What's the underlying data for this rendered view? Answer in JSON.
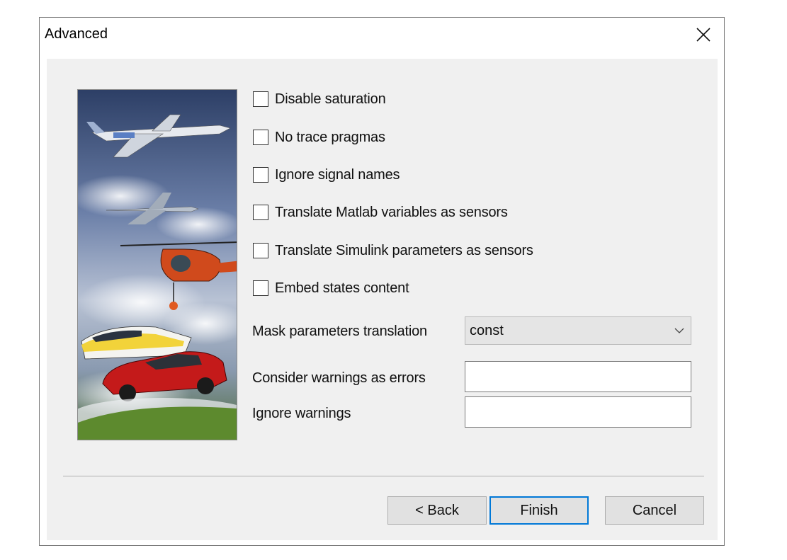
{
  "dialog": {
    "title": "Advanced",
    "close_icon": "close-icon"
  },
  "picture": {
    "description_icon": "vehicles-collage-image"
  },
  "options": [
    {
      "label": "Disable saturation",
      "checked": false
    },
    {
      "label": "No trace pragmas",
      "checked": false
    },
    {
      "label": "Ignore signal names",
      "checked": false
    },
    {
      "label": "Translate Matlab variables as sensors",
      "checked": false
    },
    {
      "label": "Translate Simulink parameters as sensors",
      "checked": false
    },
    {
      "label": "Embed states content",
      "checked": false
    }
  ],
  "mask_parameters": {
    "label": "Mask parameters translation",
    "value": "const"
  },
  "warnings_as_errors": {
    "label": "Consider warnings as errors",
    "value": ""
  },
  "ignore_warnings": {
    "label": "Ignore warnings",
    "value": ""
  },
  "buttons": {
    "back": "< Back",
    "finish": "Finish",
    "cancel": "Cancel"
  },
  "colors": {
    "accent": "#0078d7",
    "client_bg": "#f0f0f0",
    "button_bg": "#e1e1e1"
  }
}
